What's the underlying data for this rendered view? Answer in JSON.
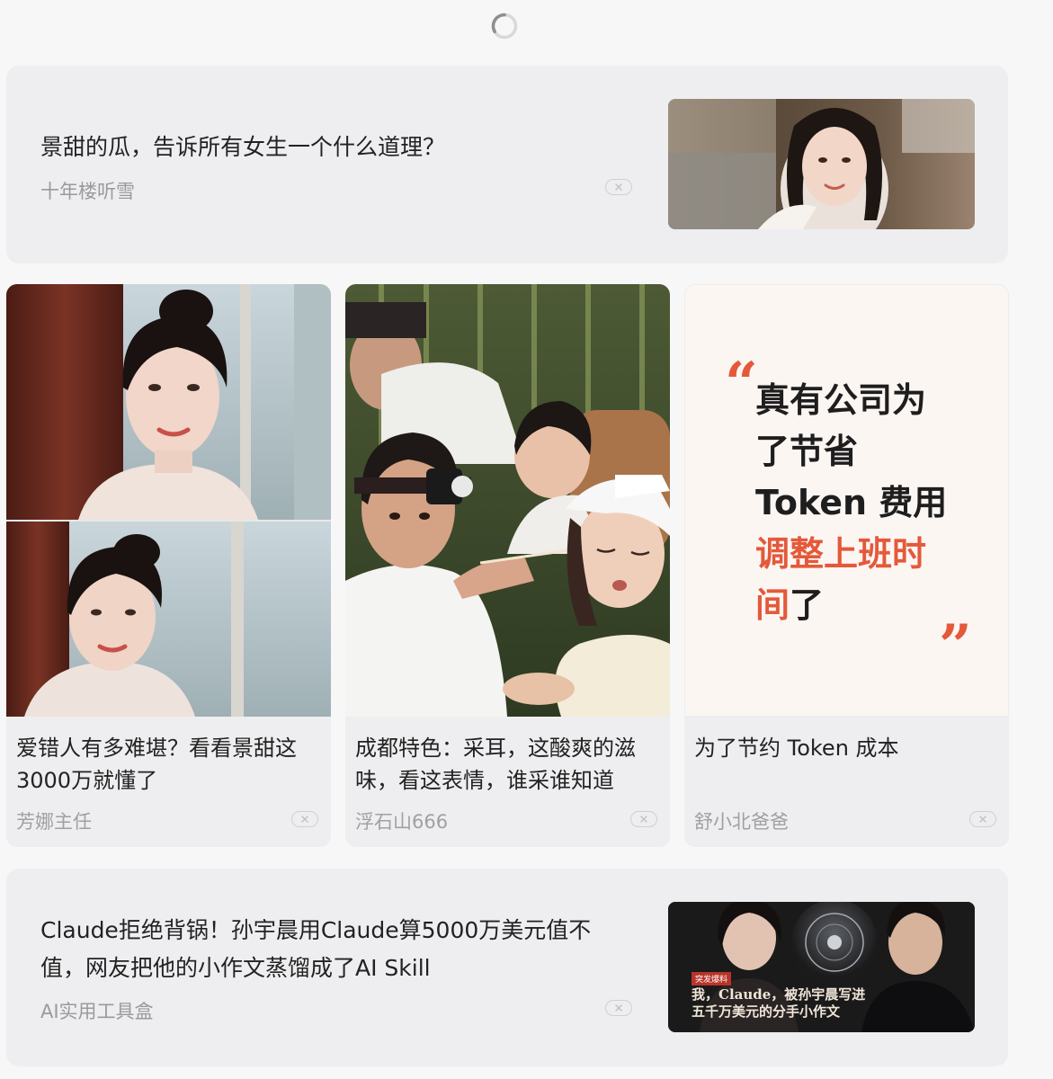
{
  "feed": {
    "card1": {
      "title": "景甜的瓜，告诉所有女生一个什么道理？",
      "author": "十年楼听雪",
      "thumb_icon": "woman-portrait-image"
    },
    "grid": [
      {
        "title": "爱错人有多难堪？看看景甜这3000万就懂了",
        "author": "芳娜主任",
        "image_icon": "actress-portrait-image"
      },
      {
        "title": "成都特色：采耳，这酸爽的滋味，看这表情，谁采谁知道",
        "author": "浮石山666",
        "image_icon": "ear-cleaning-scene-image"
      },
      {
        "title": "为了节约 Token 成本",
        "author": "舒小北爸爸",
        "quote": {
          "line1": "真有公司为",
          "line2": "了节省",
          "line3": "Token 费用",
          "line4_highlight": "调整上班时",
          "line5_highlight": "间",
          "line5_tail": "了",
          "open_mark": "“",
          "close_mark": "”"
        }
      }
    ],
    "card2": {
      "title": "Claude拒绝背锅！孙宇晨用Claude算5000万美元值不值，网友把他的小作文蒸馏成了AI Skill",
      "author": "AI实用工具盒",
      "thumb": {
        "tag": "突发爆料",
        "headline_line1": "我，Claude，被孙宇晨写进",
        "headline_line2": "五千万美元的分手小作文"
      }
    }
  },
  "colors": {
    "accent": "#e4593a",
    "card_bg": "#eeeef0",
    "muted_text": "#9a9a9a"
  }
}
